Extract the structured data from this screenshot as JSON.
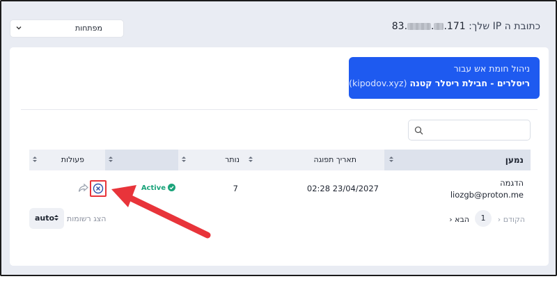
{
  "top": {
    "select_value": "מפתחות",
    "ip_label": "כתובת ה IP שלך:",
    "ip_start": "83.",
    "ip_end": ".171"
  },
  "banner": {
    "line1": "ניהול חומת אש עבור",
    "line2_bold": "ריסלרים - חבילת ריסלר קטנה",
    "line2_domain": "(kipodov.xyz)"
  },
  "table": {
    "columns": {
      "name": "נמען",
      "expires": "תאריך תפוגה",
      "remaining": "נותר",
      "blank": "",
      "actions": "פעולות"
    },
    "rows": [
      {
        "name": "הדגמה",
        "email": "liozgb@proton.me",
        "expires": "02:28 23/04/2027",
        "remaining": "7",
        "status": "Active"
      }
    ]
  },
  "footer": {
    "per_page_value": "auto",
    "per_page_label": "הצג רשומות",
    "prev": "הקודם",
    "page": "1",
    "next": "הבא"
  },
  "colors": {
    "banner": "#1e5af0",
    "status_active": "#1aa37a",
    "annotation": "#e8343a"
  }
}
